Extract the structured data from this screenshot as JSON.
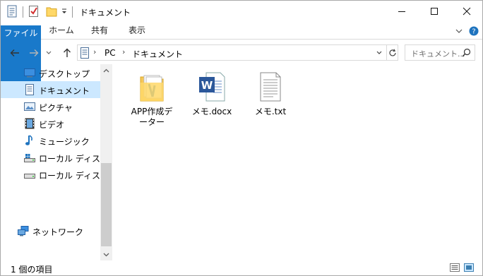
{
  "window": {
    "title": "ドキュメント"
  },
  "ribbon": {
    "tabs": [
      {
        "label": "ファイル"
      },
      {
        "label": "ホーム"
      },
      {
        "label": "共有"
      },
      {
        "label": "表示"
      }
    ]
  },
  "address": {
    "crumbs": [
      "PC",
      "ドキュメント"
    ],
    "search_placeholder": "ドキュメント..."
  },
  "sidebar": {
    "items": [
      {
        "label": "デスクトップ",
        "icon": "desktop-icon"
      },
      {
        "label": "ドキュメント",
        "icon": "documents-icon",
        "selected": true
      },
      {
        "label": "ピクチャ",
        "icon": "pictures-icon"
      },
      {
        "label": "ビデオ",
        "icon": "videos-icon"
      },
      {
        "label": "ミュージック",
        "icon": "music-icon"
      },
      {
        "label": "ローカル ディスク (C",
        "icon": "drive-icon"
      },
      {
        "label": "ローカル ディスク (D",
        "icon": "drive-icon"
      },
      {
        "label": "ネットワーク",
        "icon": "network-icon"
      }
    ]
  },
  "files": [
    {
      "name": "APP作成デ\nーター",
      "line1": "APP作成デ",
      "line2": "ーター",
      "icon": "folder-icon"
    },
    {
      "name": "メモ.docx",
      "line1": "メモ.docx",
      "line2": "",
      "icon": "word-document-icon"
    },
    {
      "name": "メモ.txt",
      "line1": "メモ.txt",
      "line2": "",
      "icon": "text-file-icon"
    }
  ],
  "status": {
    "item_count": "1 個の項目"
  },
  "colors": {
    "accent": "#1979ca",
    "selection": "#cce8ff"
  }
}
